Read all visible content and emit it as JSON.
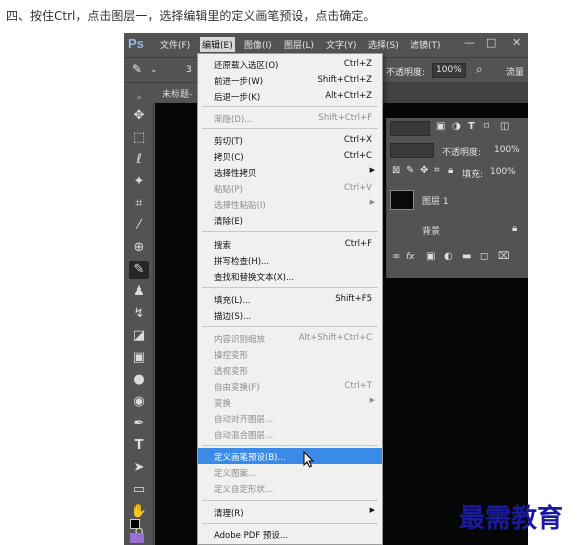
{
  "instruction": "四、按住Ctrl，点击图层一，选择编辑里的定义画笔预设，点击确定。",
  "app": {
    "logo": "Ps",
    "menus": [
      "文件(F)",
      "编辑(E)",
      "图像(I)",
      "图层(L)",
      "文字(Y)",
      "选择(S)",
      "滤镜(T)"
    ],
    "window_controls": [
      "—",
      "□",
      "✕"
    ]
  },
  "options_bar": {
    "brush_size": "3",
    "opacity_label": "不透明度:",
    "opacity_value": "100%",
    "flow_label": "流量"
  },
  "document_tab": "未标题-",
  "panel": {
    "opacity_label": "不透明度:",
    "opacity_value": "100%",
    "fill_label": "填充:",
    "fill_value": "100%",
    "layer1": "图层 1",
    "background": "背景",
    "footer_text": "fx"
  },
  "edit_menu": {
    "items": [
      {
        "label": "还原载入选区(O)",
        "shortcut": "Ctrl+Z",
        "disabled": false
      },
      {
        "label": "前进一步(W)",
        "shortcut": "Shift+Ctrl+Z",
        "disabled": false
      },
      {
        "label": "后退一步(K)",
        "shortcut": "Alt+Ctrl+Z",
        "disabled": false
      },
      {
        "label": "渐隐(D)...",
        "shortcut": "Shift+Ctrl+F",
        "disabled": true
      },
      {
        "label": "剪切(T)",
        "shortcut": "Ctrl+X",
        "disabled": false
      },
      {
        "label": "拷贝(C)",
        "shortcut": "Ctrl+C",
        "disabled": false
      },
      {
        "label": "选择性拷贝",
        "shortcut": "",
        "disabled": false,
        "submenu": true
      },
      {
        "label": "粘贴(P)",
        "shortcut": "Ctrl+V",
        "disabled": true
      },
      {
        "label": "选择性粘贴(I)",
        "shortcut": "",
        "disabled": true,
        "submenu": true
      },
      {
        "label": "清除(E)",
        "shortcut": "",
        "disabled": false
      },
      {
        "label": "搜索",
        "shortcut": "Ctrl+F",
        "disabled": false
      },
      {
        "label": "拼写检查(H)...",
        "shortcut": "",
        "disabled": false
      },
      {
        "label": "查找和替换文本(X)...",
        "shortcut": "",
        "disabled": false
      },
      {
        "label": "填充(L)...",
        "shortcut": "Shift+F5",
        "disabled": false
      },
      {
        "label": "描边(S)...",
        "shortcut": "",
        "disabled": false
      },
      {
        "label": "内容识别缩放",
        "shortcut": "Alt+Shift+Ctrl+C",
        "disabled": true
      },
      {
        "label": "操控变形",
        "shortcut": "",
        "disabled": true
      },
      {
        "label": "透视变形",
        "shortcut": "",
        "disabled": true
      },
      {
        "label": "自由变换(F)",
        "shortcut": "Ctrl+T",
        "disabled": true
      },
      {
        "label": "变换",
        "shortcut": "",
        "disabled": true,
        "submenu": true
      },
      {
        "label": "自动对齐图层...",
        "shortcut": "",
        "disabled": true
      },
      {
        "label": "自动混合图层...",
        "shortcut": "",
        "disabled": true
      },
      {
        "label": "定义画笔预设(B)...",
        "shortcut": "",
        "disabled": false,
        "highlight": true
      },
      {
        "label": "定义图案...",
        "shortcut": "",
        "disabled": true
      },
      {
        "label": "定义自定形状...",
        "shortcut": "",
        "disabled": true
      },
      {
        "label": "清理(R)",
        "shortcut": "",
        "disabled": false,
        "submenu": true
      },
      {
        "label": "Adobe PDF 预设...",
        "shortcut": "",
        "disabled": false
      }
    ]
  },
  "watermark": "最需教育",
  "colors": {
    "ps_dark": "#535353",
    "canvas": "#060606",
    "highlight": "#3a8be8",
    "watermark": "#1a1aa0"
  }
}
